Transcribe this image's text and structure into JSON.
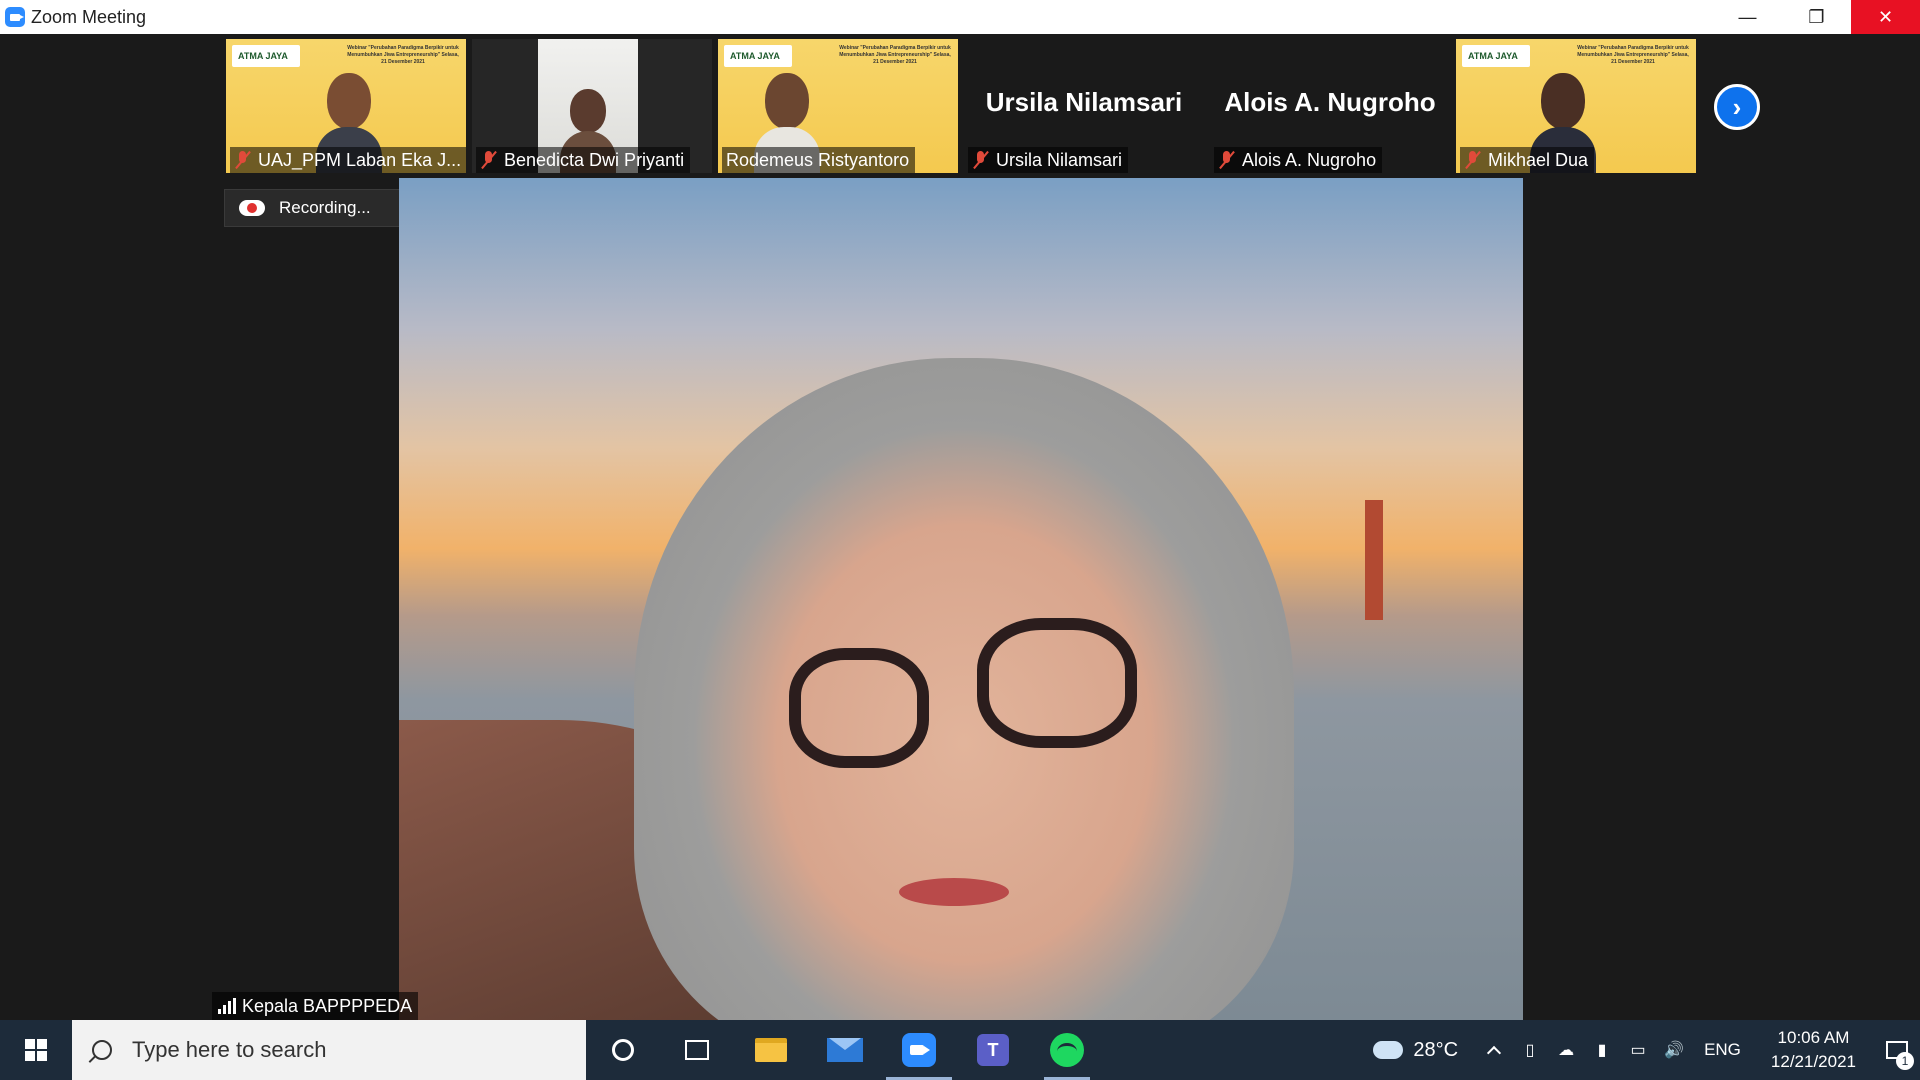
{
  "window": {
    "title": "Zoom Meeting",
    "minimize": "—",
    "restore": "❐",
    "close": "✕"
  },
  "gallery": {
    "participants": [
      {
        "name": "UAJ_PPM Laban Eka J...",
        "type": "banner",
        "banner_logo": "ATMA JAYA"
      },
      {
        "name": "Benedicta Dwi Priyanti",
        "type": "white"
      },
      {
        "name": "Rodemeus Ristyantoro",
        "type": "banner",
        "banner_logo": "ATMA JAYA"
      },
      {
        "name": "Ursila Nilamsari",
        "type": "name",
        "display": "Ursila Nilamsari"
      },
      {
        "name": "Alois A. Nugroho",
        "type": "name",
        "display": "Alois A. Nugroho"
      },
      {
        "name": "Mikhael Dua",
        "type": "banner",
        "banner_logo": "ATMA JAYA"
      }
    ],
    "banner_text": "Webinar \"Perubahan Paradigma Berpikir untuk Menumbuhkan Jiwa Entrepreneurship\" Selasa, 21 Desember 2021",
    "next_arrow": "›"
  },
  "recording": {
    "label": "Recording..."
  },
  "active_speaker": {
    "name": "Kepala BAPPPPEDA"
  },
  "taskbar": {
    "search_placeholder": "Type here to search",
    "weather": "28°C",
    "language": "ENG",
    "time": "10:06 AM",
    "date": "12/21/2021",
    "notification_count": "1",
    "teams_letter": "T"
  }
}
